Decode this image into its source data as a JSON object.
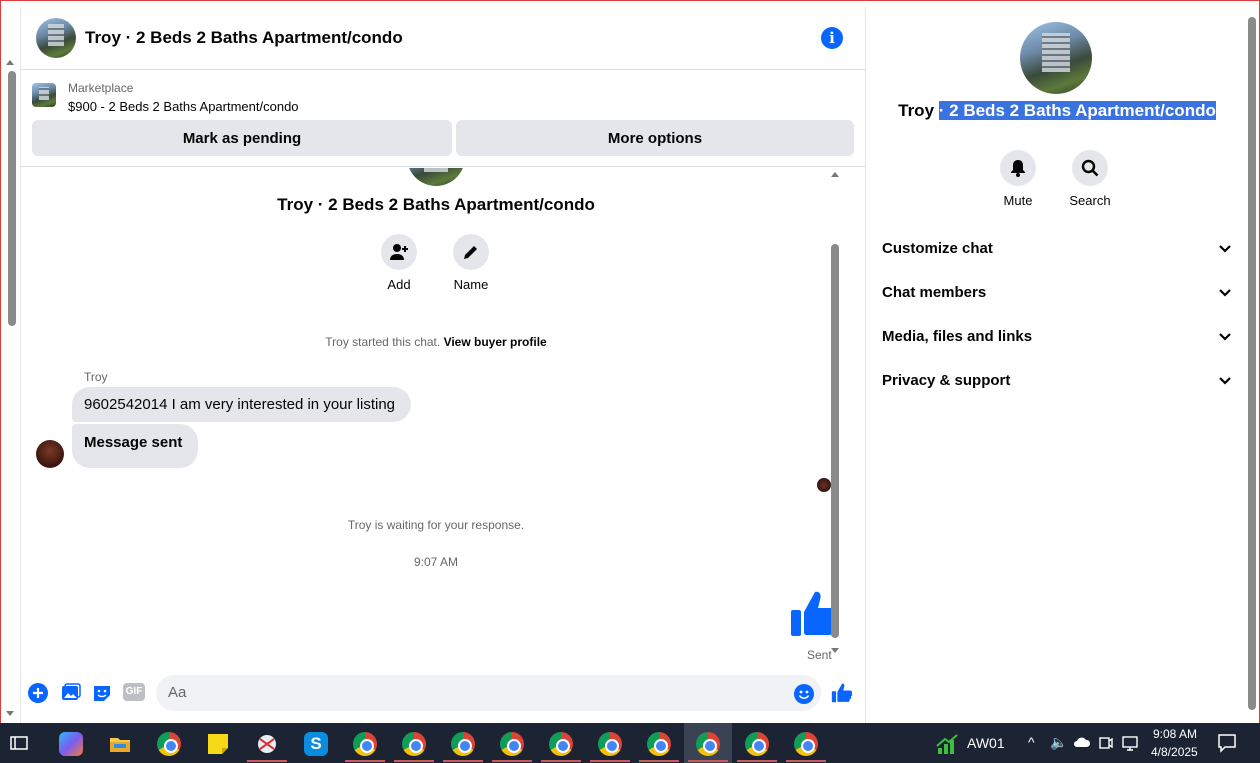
{
  "chat": {
    "title": "Troy · 2 Beds 2 Baths Apartment/condo",
    "listing": {
      "source": "Marketplace",
      "title": "$900 - 2 Beds 2 Baths Apartment/condo",
      "mark_pending": "Mark as pending",
      "more_options": "More options"
    },
    "conversation_title": "Troy · 2 Beds 2 Baths Apartment/condo",
    "actions": {
      "add": "Add",
      "name": "Name"
    },
    "started_text": "Troy started this chat.",
    "view_buyer_profile": "View buyer profile",
    "sender_name": "Troy",
    "messages": [
      "9602542014 I am very interested in your listing",
      "Message sent"
    ],
    "waiting_text": "Troy is waiting for your response.",
    "timestamp": "9:07 AM",
    "sent_label": "Sent",
    "composer_placeholder": "Aa",
    "composer_icons": [
      "plus-icon",
      "photo-icon",
      "sticker-icon",
      "gif-icon",
      "emoji-icon",
      "thumbs-up-icon"
    ],
    "gif_label": "GIF"
  },
  "right_panel": {
    "title_prefix": "Troy",
    "title_selected": "· 2 Beds 2 Baths Apartment/condo",
    "mute": "Mute",
    "search": "Search",
    "sections": [
      "Customize chat",
      "Chat members",
      "Media, files and links",
      "Privacy & support"
    ]
  },
  "taskbar": {
    "tray_label": "AW01",
    "time": "9:08 AM",
    "date": "4/8/2025",
    "chrome_count": 10
  },
  "colors": {
    "accent": "#0866ff",
    "selection": "#3a73e0",
    "taskbar": "#1c2433"
  }
}
